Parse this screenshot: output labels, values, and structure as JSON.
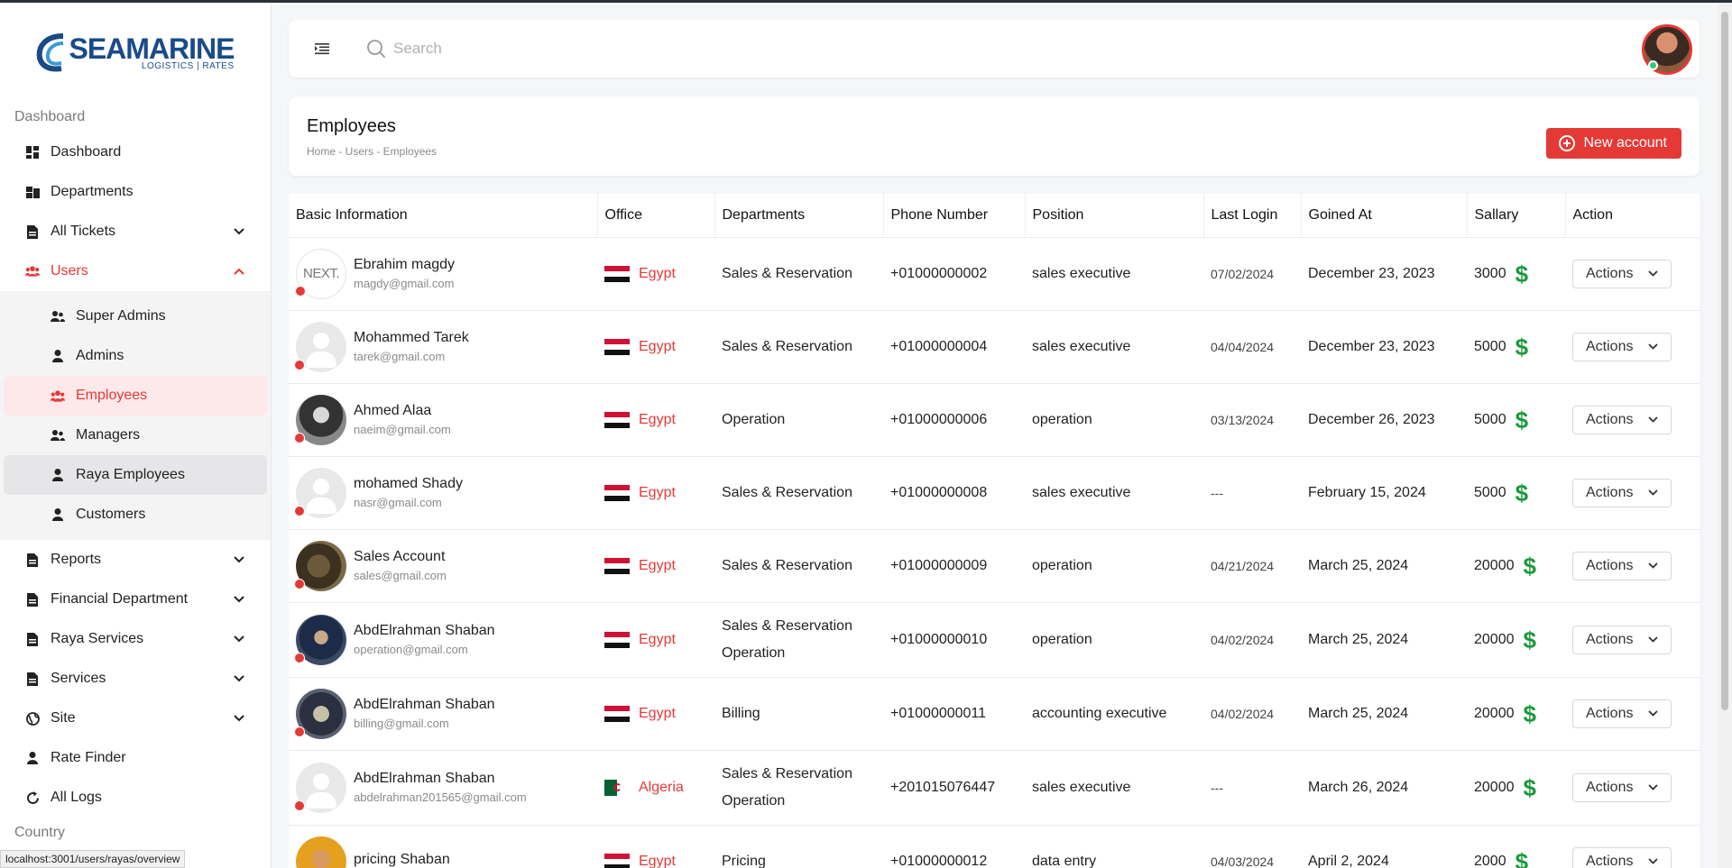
{
  "brand": {
    "name": "SEAMARINE",
    "tagline": "LOGISTICS | RATES"
  },
  "sidebar": {
    "section_dashboard": "Dashboard",
    "items": [
      {
        "label": "Dashboard",
        "icon": "dashboard-icon"
      },
      {
        "label": "Departments",
        "icon": "departments-icon"
      },
      {
        "label": "All Tickets",
        "icon": "document-icon",
        "expandable": true
      },
      {
        "label": "Users",
        "icon": "users-icon",
        "expanded": true
      }
    ],
    "submenu": [
      {
        "label": "Super Admins",
        "icon": "user-group-icon"
      },
      {
        "label": "Admins",
        "icon": "user-icon"
      },
      {
        "label": "Employees",
        "icon": "users-icon",
        "active": true
      },
      {
        "label": "Managers",
        "icon": "user-group-icon"
      },
      {
        "label": "Raya Employees",
        "icon": "user-icon"
      },
      {
        "label": "Customers",
        "icon": "user-icon"
      }
    ],
    "items2": [
      {
        "label": "Reports",
        "icon": "document-icon"
      },
      {
        "label": "Financial Department",
        "icon": "document-icon"
      },
      {
        "label": "Raya Services",
        "icon": "document-icon"
      },
      {
        "label": "Services",
        "icon": "document-icon"
      },
      {
        "label": "Site",
        "icon": "globe-icon"
      },
      {
        "label": "Rate Finder",
        "icon": "user-icon"
      },
      {
        "label": "All Logs",
        "icon": "logs-icon"
      }
    ],
    "section_country": "Country"
  },
  "status_url": "localhost:3001/users/rayas/overview",
  "header": {
    "search_placeholder": "Search"
  },
  "page": {
    "title": "Employees",
    "breadcrumb": "Home - Users - Employees",
    "new_button": "New account"
  },
  "table": {
    "columns": [
      "Basic Information",
      "Office",
      "Departments",
      "Phone Number",
      "Position",
      "Last Login",
      "Goined At",
      "Sallary",
      "Action"
    ],
    "action_label": "Actions",
    "rows": [
      {
        "name": "Ebrahim magdy",
        "email": "magdy@gmail.com",
        "avatar": "next",
        "office": "Egypt",
        "departments": [
          "Sales & Reservation"
        ],
        "phone": "+01000000002",
        "position": "sales executive",
        "last_login": "07/02/2024",
        "joined": "December 23, 2023",
        "salary": "3000"
      },
      {
        "name": "Mohammed Tarek",
        "email": "tarek@gmail.com",
        "avatar": "grey",
        "office": "Egypt",
        "departments": [
          "Sales & Reservation"
        ],
        "phone": "+01000000004",
        "position": "sales executive",
        "last_login": "04/04/2024",
        "joined": "December 23, 2023",
        "salary": "5000"
      },
      {
        "name": "Ahmed Alaa",
        "email": "naeim@gmail.com",
        "avatar": "photo1",
        "office": "Egypt",
        "departments": [
          "Operation"
        ],
        "phone": "+01000000006",
        "position": "operation",
        "last_login": "03/13/2024",
        "joined": "December 26, 2023",
        "salary": "5000"
      },
      {
        "name": "mohamed Shady",
        "email": "nasr@gmail.com",
        "avatar": "grey",
        "office": "Egypt",
        "departments": [
          "Sales & Reservation"
        ],
        "phone": "+01000000008",
        "position": "sales executive",
        "last_login": "---",
        "joined": "February 15, 2024",
        "salary": "5000"
      },
      {
        "name": "Sales Account",
        "email": "sales@gmail.com",
        "avatar": "photo2",
        "office": "Egypt",
        "departments": [
          "Sales & Reservation"
        ],
        "phone": "+01000000009",
        "position": "operation",
        "last_login": "04/21/2024",
        "joined": "March 25, 2024",
        "salary": "20000"
      },
      {
        "name": "AbdElrahman Shaban",
        "email": "operation@gmail.com",
        "avatar": "photo3",
        "office": "Egypt",
        "departments": [
          "Sales & Reservation",
          "Operation"
        ],
        "phone": "+01000000010",
        "position": "operation",
        "last_login": "04/02/2024",
        "joined": "March 25, 2024",
        "salary": "20000"
      },
      {
        "name": "AbdElrahman Shaban",
        "email": "billing@gmail.com",
        "avatar": "photo4",
        "office": "Egypt",
        "departments": [
          "Billing"
        ],
        "phone": "+01000000011",
        "position": "accounting executive",
        "last_login": "04/02/2024",
        "joined": "March 25, 2024",
        "salary": "20000"
      },
      {
        "name": "AbdElrahman Shaban",
        "email": "abdelrahman201565@gmail.com",
        "avatar": "grey",
        "office": "Algeria",
        "departments": [
          "Sales & Reservation",
          "Operation"
        ],
        "phone": "+201015076447",
        "position": "sales executive",
        "last_login": "---",
        "joined": "March 26, 2024",
        "salary": "20000"
      },
      {
        "name": "pricing Shaban",
        "email": "",
        "avatar": "photo5",
        "office": "Egypt",
        "departments": [
          "Pricing"
        ],
        "phone": "+01000000012",
        "position": "data entry",
        "last_login": "04/03/2024",
        "joined": "April 2, 2024",
        "salary": "2000"
      }
    ]
  },
  "colors": {
    "accent": "#e53935",
    "salary_icon": "#1a9a3a",
    "brand": "#1a4a8a"
  }
}
